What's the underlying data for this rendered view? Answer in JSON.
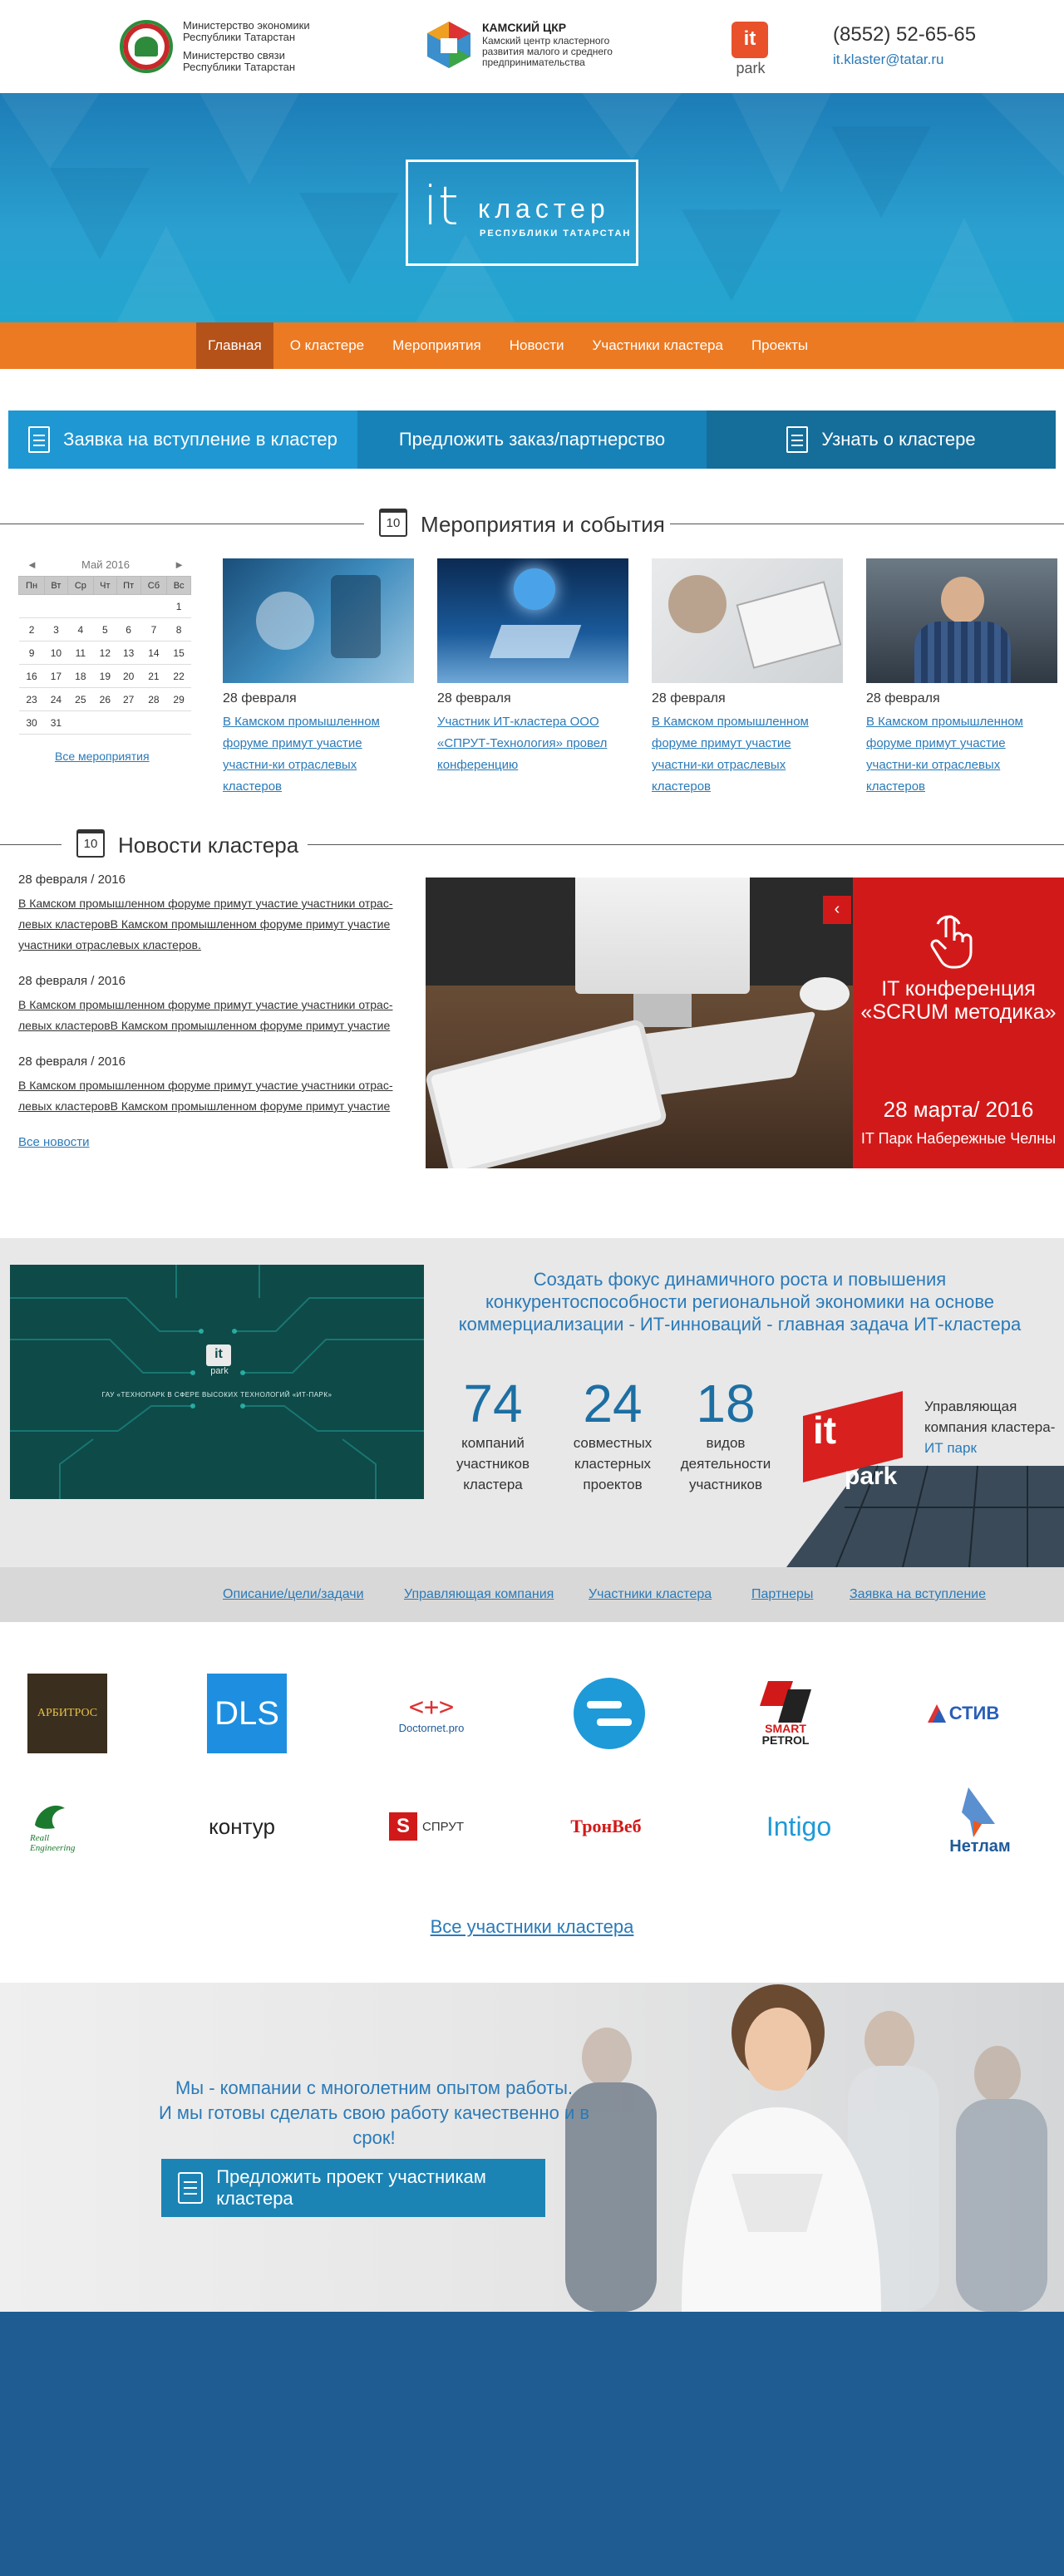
{
  "header": {
    "ministry_line1": "Министерство экономики Республики Татарстан",
    "ministry_line2": "Министерство связи Республики Татарстан",
    "kamsk_title": "КАМСКИЙ ЦКР",
    "kamsk_desc": "Камский центр кластерного развития малого и среднего предпринимательства",
    "itpark_it": "it",
    "itpark_park": "park",
    "phone": "(8552) 52-65-65",
    "email": "it.klaster@tatar.ru"
  },
  "hero": {
    "logo_it": "it",
    "logo_klaster": "кластер",
    "logo_sub": "РЕСПУБЛИКИ ТАТАРСТАН"
  },
  "nav": {
    "items": [
      "Главная",
      "О кластере",
      "Мероприятия",
      "Новости",
      "Участники кластера",
      "Проекты"
    ]
  },
  "actions": {
    "join": "Заявка на вступление в кластер",
    "offer": "Предложить заказ/партнерство",
    "learn": "Узнать о кластере",
    "colors": [
      "#1e97d2",
      "#1782b8",
      "#156d9a"
    ]
  },
  "events_section": {
    "title": "Мероприятия и события",
    "icon_day": "10"
  },
  "calendar": {
    "prev": "◄",
    "next": "►",
    "month": "Май 2016",
    "weekdays": [
      "Пн",
      "Вт",
      "Ср",
      "Чт",
      "Пт",
      "Сб",
      "Вс"
    ],
    "rows": [
      [
        "",
        "",
        "",
        "",
        "",
        "",
        "1"
      ],
      [
        "2",
        "3",
        "4",
        "5",
        "6",
        "7",
        "8"
      ],
      [
        "9",
        "10",
        "11",
        "12",
        "13",
        "14",
        "15"
      ],
      [
        "16",
        "17",
        "18",
        "19",
        "20",
        "21",
        "22"
      ],
      [
        "23",
        "24",
        "25",
        "26",
        "27",
        "28",
        "29"
      ],
      [
        "30",
        "31",
        "",
        "",
        "",
        "",
        ""
      ]
    ],
    "all_events": "Все мероприятия"
  },
  "events": [
    {
      "date": "28 февраля",
      "title": "В Камском промышленном форуме примут участие участни-ки отраслевых кластеров"
    },
    {
      "date": "28 февраля",
      "title": "Участник ИТ-кластера ООО «СПРУТ-Технология» провел конференцию"
    },
    {
      "date": "28 февраля",
      "title": "В Камском промышленном форуме примут участие участни-ки отраслевых кластеров"
    },
    {
      "date": "28 февраля",
      "title": "В Камском промышленном форуме примут участие участни-ки отраслевых кластеров"
    }
  ],
  "news_section": {
    "title": "Новости кластера",
    "icon_day": "10"
  },
  "news": [
    {
      "date": "28 февраля / 2016",
      "text": "В Камском промышленном форуме примут участие участники отрас-левых кластеровВ Камском промышленном форуме примут участие участники отраслевых кластеров."
    },
    {
      "date": "28 февраля / 2016",
      "text": "В Камском промышленном форуме примут участие участники отрас-левых кластеровВ Камском промышленном форуме примут участие"
    },
    {
      "date": "28 февраля / 2016",
      "text": "В Камском промышленном форуме примут участие участники отрас-левых кластеровВ Камском промышленном форуме примут участие"
    }
  ],
  "all_news": "Все новости",
  "featured": {
    "title": "IT конференция «SCRUM методика»",
    "date": "28 марта/ 2016",
    "place": "IT Парк Набережные Челны",
    "prev": "‹",
    "next": "›"
  },
  "stats": {
    "video_caption": "ГАУ «ТЕХНОПАРК В СФЕРЕ ВЫСОКИХ ТЕХНОЛОГИЙ «ИТ-ПАРК»",
    "video_it": "it",
    "video_park": "park",
    "mission": "Создать фокус динамичного роста и повышения конкурентоспособности региональной экономики на основе коммерциализации - ИТ-инноваций - главная задача ИТ-кластера",
    "items": [
      {
        "value": "74",
        "label": "компаний участников кластера"
      },
      {
        "value": "24",
        "label": "совместных кластерных проектов"
      },
      {
        "value": "18",
        "label": "видов деятельности участников"
      }
    ],
    "mgmt_text": "Управляющая компания кластера-",
    "mgmt_link": "ИТ парк",
    "building_it": "it",
    "building_park": "park"
  },
  "sublinks": [
    "Описание/цели/задачи",
    "Управляющая компания",
    "Участники кластера",
    "Партнеры",
    "Заявка на вступление"
  ],
  "partners": {
    "arbitros": "АРБИТРОС",
    "dls": "DLS",
    "doctornet": "Doctornet.pro",
    "doctornet_sign": "<+>",
    "smart": "SMART",
    "petrol": "PETROL",
    "stiv": "СТИВ",
    "reall": "Reall Engineering",
    "kontur": "контур",
    "sprut": "СПРУТ",
    "sprut_s": "S",
    "tronweb": "ТронВеб",
    "intigo": "Intigo",
    "netkam": "Нетлам"
  },
  "all_partners": "Все участники кластера",
  "cta": {
    "line1": "Мы - компании с многолетним опытом работы.",
    "line2": "И мы готовы сделать свою работу качественно и в срок!",
    "button": "Предложить проект участникам кластера"
  },
  "colors": {
    "orange_nav": "#ec7a22",
    "nav_active": "#b5521a",
    "brand_blue": "#2a7ab8",
    "red_card": "#d21919",
    "footer": "#1f5c92"
  }
}
